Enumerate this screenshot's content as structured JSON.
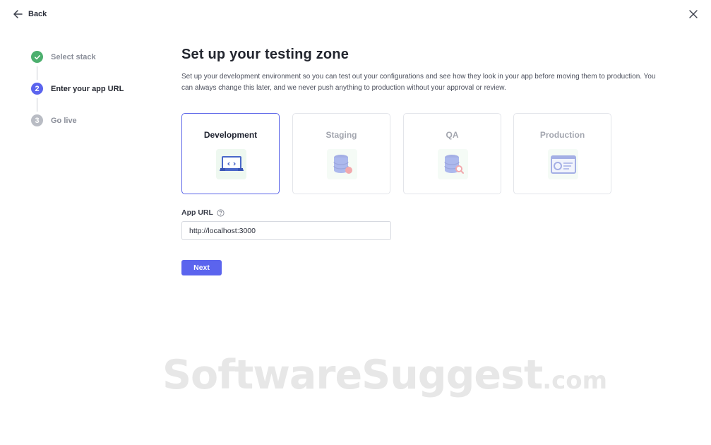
{
  "header": {
    "back_label": "Back"
  },
  "steps": [
    {
      "number": "",
      "label": "Select stack",
      "state": "done",
      "color": "#4caf6e"
    },
    {
      "number": "2",
      "label": "Enter your app URL",
      "state": "current",
      "color": "#5b64ee"
    },
    {
      "number": "3",
      "label": "Go live",
      "state": "upcoming",
      "color": "#b9bcc4"
    }
  ],
  "main": {
    "title": "Set up your testing zone",
    "description": "Set up your development environment so you can test out your configurations and see how they look in your app before moving them to production. You can always change this later, and we never push anything to production without your approval or review.",
    "environments": [
      {
        "label": "Development",
        "icon": "laptop-code-icon",
        "selected": true
      },
      {
        "label": "Staging",
        "icon": "database-alert-icon",
        "selected": false
      },
      {
        "label": "QA",
        "icon": "database-search-icon",
        "selected": false
      },
      {
        "label": "Production",
        "icon": "browser-window-icon",
        "selected": false
      }
    ],
    "app_url": {
      "label": "App URL",
      "value": "http://localhost:3000"
    },
    "next_label": "Next"
  },
  "watermark": {
    "main": "SoftwareSuggest",
    "suffix": ".com"
  },
  "colors": {
    "accent": "#5b64ee",
    "success": "#4caf6e",
    "icon_bg": "#eef8f0"
  }
}
